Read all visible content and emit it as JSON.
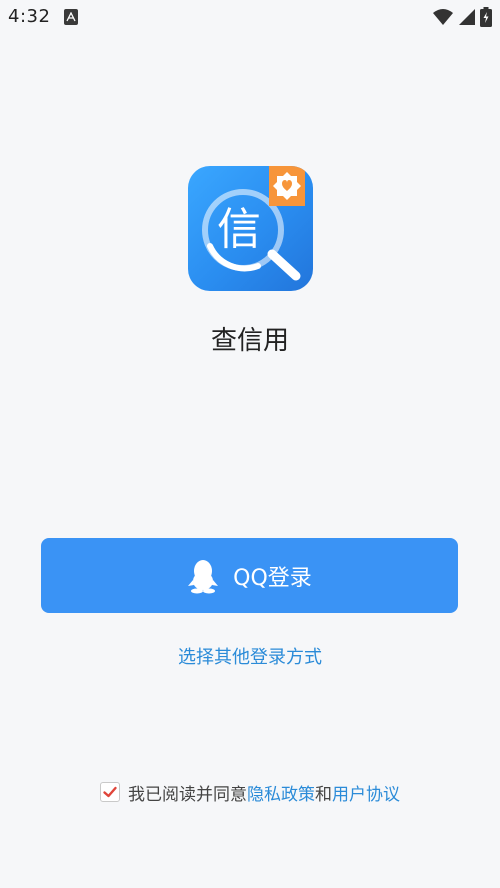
{
  "status_bar": {
    "time": "4:32",
    "icons": [
      "a-notification-icon",
      "wifi-icon",
      "signal-icon",
      "battery-charging-icon"
    ]
  },
  "app": {
    "name": "查信用",
    "logo_char": "信",
    "logo_colors": {
      "primary": "#2a8df0",
      "badge": "#f7953a"
    }
  },
  "login": {
    "qq_label": "QQ登录",
    "qq_button_color": "#3a93f5",
    "other_label": "选择其他登录方式"
  },
  "agreement": {
    "checked": true,
    "prefix": "我已阅读并同意",
    "privacy_label": "隐私政策",
    "conjunction": "和",
    "terms_label": "用户协议",
    "link_color": "#2b8bd8"
  }
}
